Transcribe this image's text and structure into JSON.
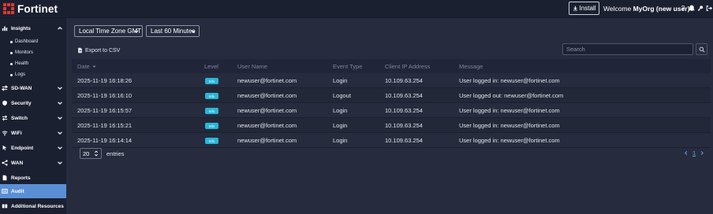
{
  "header": {
    "logo_text": "Fortinet",
    "install_label": "Install",
    "welcome_prefix": "Welcome",
    "welcome_user": "MyOrg (new user)",
    "icons": [
      "help-icon",
      "bell-icon",
      "key-icon",
      "logout-icon"
    ]
  },
  "sidebar": {
    "items": [
      {
        "label": "Insights",
        "icon": "chart-icon"
      },
      {
        "label": "SD-WAN",
        "icon": "sdwan-icon"
      },
      {
        "label": "Security",
        "icon": "shield-icon"
      },
      {
        "label": "Switch",
        "icon": "switch-icon"
      },
      {
        "label": "WiFi",
        "icon": "wifi-icon"
      },
      {
        "label": "Endpoint",
        "icon": "endpoint-icon"
      },
      {
        "label": "WAN",
        "icon": "wan-icon"
      },
      {
        "label": "Reports",
        "icon": "report-icon"
      },
      {
        "label": "Audit",
        "icon": "audit-icon"
      },
      {
        "label": "Additional Resources",
        "icon": "book-icon"
      }
    ],
    "subitems": [
      "Dashboard",
      "Monitors",
      "Health",
      "Logs"
    ],
    "active": "Audit",
    "active_color": "#5a8fd6"
  },
  "filters": {
    "timezone": "Local Time Zone GMT",
    "range": "Last 60 Minutes"
  },
  "toolbar": {
    "export_label": "Export to CSV",
    "search_placeholder": "Search"
  },
  "table": {
    "columns": [
      "Date",
      "Level",
      "User Name",
      "Event Type",
      "Client IP Address",
      "Message"
    ],
    "rows": [
      {
        "date": "2025-11-19 16:18:26",
        "level": "Info",
        "user": "newuser@fortinet.com",
        "event": "Login",
        "ip": "10.109.63.254",
        "message": "User logged in: newuser@fortinet.com"
      },
      {
        "date": "2025-11-19 16:16:10",
        "level": "Info",
        "user": "newuser@fortinet.com",
        "event": "Logout",
        "ip": "10.109.63.254",
        "message": "User logged out: newuser@fortinet.com"
      },
      {
        "date": "2025-11-19 16:15:57",
        "level": "Info",
        "user": "newuser@fortinet.com",
        "event": "Login",
        "ip": "10.109.63.254",
        "message": "User logged in: newuser@fortinet.com"
      },
      {
        "date": "2025-11-19 16:15:21",
        "level": "Info",
        "user": "newuser@fortinet.com",
        "event": "Login",
        "ip": "10.109.63.254",
        "message": "User logged in: newuser@fortinet.com"
      },
      {
        "date": "2025-11-19 16:14:14",
        "level": "Info",
        "user": "newuser@fortinet.com",
        "event": "Login",
        "ip": "10.109.63.254",
        "message": "User logged in: newuser@fortinet.com"
      }
    ],
    "level_color": "#29b6d9"
  },
  "footer": {
    "page_size": "20",
    "entries_label": "entries",
    "page": "1"
  }
}
